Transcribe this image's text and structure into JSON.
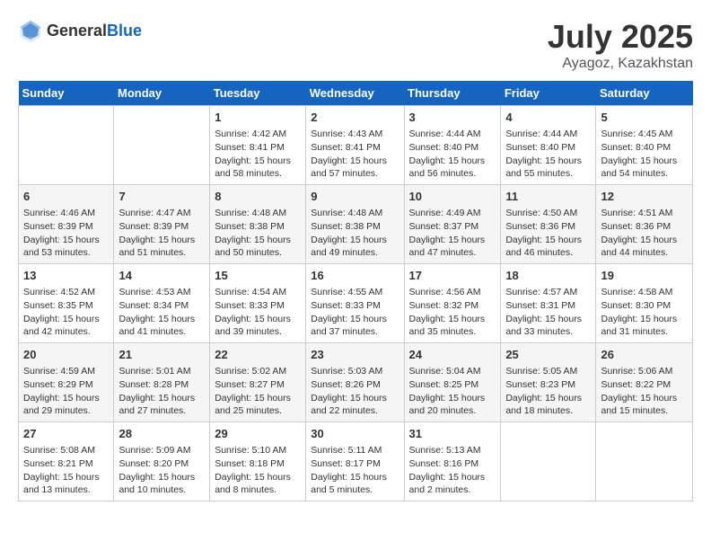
{
  "header": {
    "logo_general": "General",
    "logo_blue": "Blue",
    "title": "July 2025",
    "location": "Ayagoz, Kazakhstan"
  },
  "weekdays": [
    "Sunday",
    "Monday",
    "Tuesday",
    "Wednesday",
    "Thursday",
    "Friday",
    "Saturday"
  ],
  "weeks": [
    [
      {
        "day": "",
        "empty": true
      },
      {
        "day": "",
        "empty": true
      },
      {
        "day": "1",
        "sunrise": "4:42 AM",
        "sunset": "8:41 PM",
        "daylight": "15 hours and 58 minutes."
      },
      {
        "day": "2",
        "sunrise": "4:43 AM",
        "sunset": "8:41 PM",
        "daylight": "15 hours and 57 minutes."
      },
      {
        "day": "3",
        "sunrise": "4:44 AM",
        "sunset": "8:40 PM",
        "daylight": "15 hours and 56 minutes."
      },
      {
        "day": "4",
        "sunrise": "4:44 AM",
        "sunset": "8:40 PM",
        "daylight": "15 hours and 55 minutes."
      },
      {
        "day": "5",
        "sunrise": "4:45 AM",
        "sunset": "8:40 PM",
        "daylight": "15 hours and 54 minutes."
      }
    ],
    [
      {
        "day": "6",
        "sunrise": "4:46 AM",
        "sunset": "8:39 PM",
        "daylight": "15 hours and 53 minutes."
      },
      {
        "day": "7",
        "sunrise": "4:47 AM",
        "sunset": "8:39 PM",
        "daylight": "15 hours and 51 minutes."
      },
      {
        "day": "8",
        "sunrise": "4:48 AM",
        "sunset": "8:38 PM",
        "daylight": "15 hours and 50 minutes."
      },
      {
        "day": "9",
        "sunrise": "4:48 AM",
        "sunset": "8:38 PM",
        "daylight": "15 hours and 49 minutes."
      },
      {
        "day": "10",
        "sunrise": "4:49 AM",
        "sunset": "8:37 PM",
        "daylight": "15 hours and 47 minutes."
      },
      {
        "day": "11",
        "sunrise": "4:50 AM",
        "sunset": "8:36 PM",
        "daylight": "15 hours and 46 minutes."
      },
      {
        "day": "12",
        "sunrise": "4:51 AM",
        "sunset": "8:36 PM",
        "daylight": "15 hours and 44 minutes."
      }
    ],
    [
      {
        "day": "13",
        "sunrise": "4:52 AM",
        "sunset": "8:35 PM",
        "daylight": "15 hours and 42 minutes."
      },
      {
        "day": "14",
        "sunrise": "4:53 AM",
        "sunset": "8:34 PM",
        "daylight": "15 hours and 41 minutes."
      },
      {
        "day": "15",
        "sunrise": "4:54 AM",
        "sunset": "8:33 PM",
        "daylight": "15 hours and 39 minutes."
      },
      {
        "day": "16",
        "sunrise": "4:55 AM",
        "sunset": "8:33 PM",
        "daylight": "15 hours and 37 minutes."
      },
      {
        "day": "17",
        "sunrise": "4:56 AM",
        "sunset": "8:32 PM",
        "daylight": "15 hours and 35 minutes."
      },
      {
        "day": "18",
        "sunrise": "4:57 AM",
        "sunset": "8:31 PM",
        "daylight": "15 hours and 33 minutes."
      },
      {
        "day": "19",
        "sunrise": "4:58 AM",
        "sunset": "8:30 PM",
        "daylight": "15 hours and 31 minutes."
      }
    ],
    [
      {
        "day": "20",
        "sunrise": "4:59 AM",
        "sunset": "8:29 PM",
        "daylight": "15 hours and 29 minutes."
      },
      {
        "day": "21",
        "sunrise": "5:01 AM",
        "sunset": "8:28 PM",
        "daylight": "15 hours and 27 minutes."
      },
      {
        "day": "22",
        "sunrise": "5:02 AM",
        "sunset": "8:27 PM",
        "daylight": "15 hours and 25 minutes."
      },
      {
        "day": "23",
        "sunrise": "5:03 AM",
        "sunset": "8:26 PM",
        "daylight": "15 hours and 22 minutes."
      },
      {
        "day": "24",
        "sunrise": "5:04 AM",
        "sunset": "8:25 PM",
        "daylight": "15 hours and 20 minutes."
      },
      {
        "day": "25",
        "sunrise": "5:05 AM",
        "sunset": "8:23 PM",
        "daylight": "15 hours and 18 minutes."
      },
      {
        "day": "26",
        "sunrise": "5:06 AM",
        "sunset": "8:22 PM",
        "daylight": "15 hours and 15 minutes."
      }
    ],
    [
      {
        "day": "27",
        "sunrise": "5:08 AM",
        "sunset": "8:21 PM",
        "daylight": "15 hours and 13 minutes."
      },
      {
        "day": "28",
        "sunrise": "5:09 AM",
        "sunset": "8:20 PM",
        "daylight": "15 hours and 10 minutes."
      },
      {
        "day": "29",
        "sunrise": "5:10 AM",
        "sunset": "8:18 PM",
        "daylight": "15 hours and 8 minutes."
      },
      {
        "day": "30",
        "sunrise": "5:11 AM",
        "sunset": "8:17 PM",
        "daylight": "15 hours and 5 minutes."
      },
      {
        "day": "31",
        "sunrise": "5:13 AM",
        "sunset": "8:16 PM",
        "daylight": "15 hours and 2 minutes."
      },
      {
        "day": "",
        "empty": true
      },
      {
        "day": "",
        "empty": true
      }
    ]
  ],
  "labels": {
    "sunrise": "Sunrise:",
    "sunset": "Sunset:",
    "daylight": "Daylight:"
  }
}
